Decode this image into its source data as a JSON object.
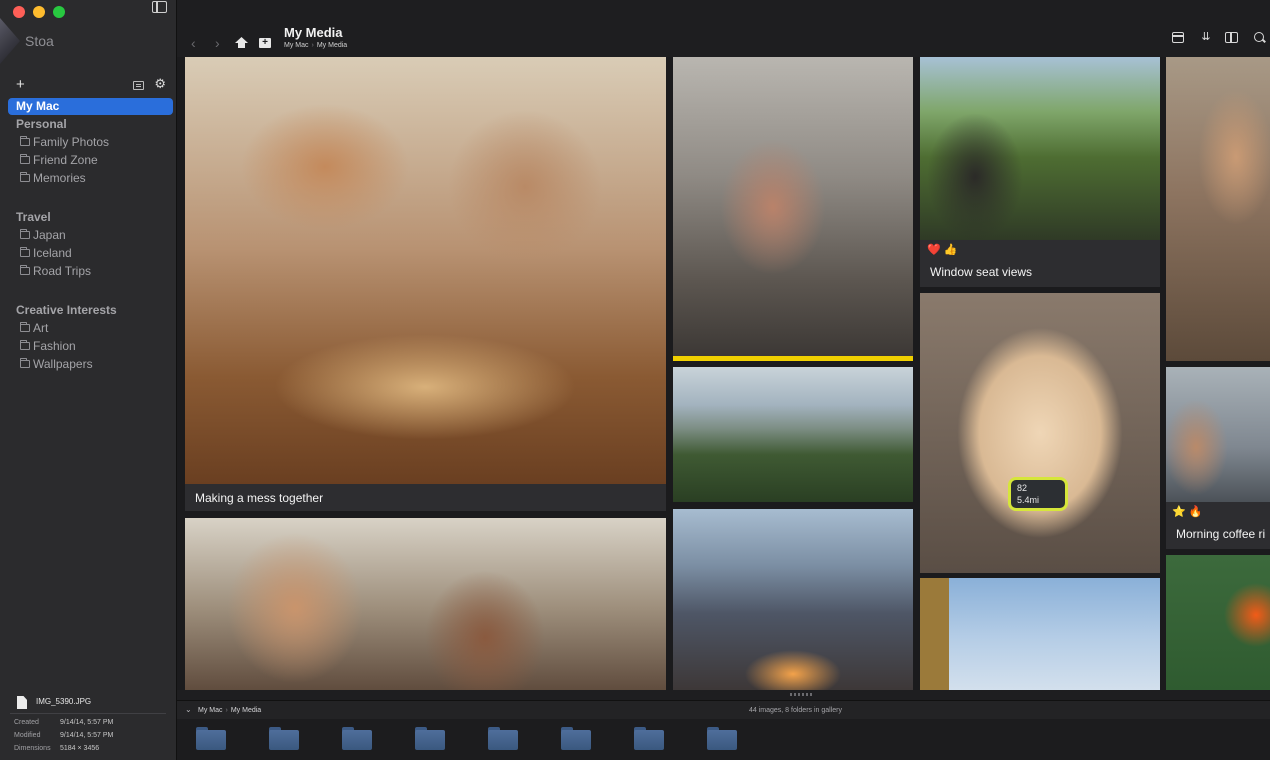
{
  "sidebar": {
    "brand": "Stoa",
    "add_label": "+",
    "active_item": "My Mac",
    "sections": [
      {
        "title": "Personal",
        "folders": [
          "Family Photos",
          "Friend Zone",
          "Memories"
        ]
      },
      {
        "title": "Travel",
        "folders": [
          "Japan",
          "Iceland",
          "Road Trips"
        ]
      },
      {
        "title": "Creative Interests",
        "folders": [
          "Art",
          "Fashion",
          "Wallpapers"
        ]
      }
    ]
  },
  "file_info": {
    "file_name": "IMG_5390.JPG",
    "rows": [
      {
        "label": "Created",
        "value": "9/14/14, 5:57 PM"
      },
      {
        "label": "Modified",
        "value": "9/14/14, 5:57 PM"
      },
      {
        "label": "Dimensions",
        "value": "5184 × 3456"
      }
    ]
  },
  "toolbar": {
    "title": "My Media",
    "breadcrumb": [
      "My Mac",
      "My Media"
    ],
    "icons": [
      "back-icon",
      "forward-icon",
      "home-icon",
      "new-folder-icon",
      "layout-icon",
      "sort-icon",
      "columns-icon",
      "zoom-icon"
    ]
  },
  "gallery": {
    "tiles": [
      {
        "name": "kids-baking",
        "caption": "Making a mess together",
        "reactions": ""
      },
      {
        "name": "woman-coffee",
        "caption": "",
        "reactions": "",
        "selected": true
      },
      {
        "name": "train-window",
        "caption": "Window seat views",
        "reactions": "❤️ 👍"
      },
      {
        "name": "cyclist",
        "caption": "",
        "reactions": ""
      },
      {
        "name": "mountains",
        "caption": "",
        "reactions": ""
      },
      {
        "name": "french-bulldog",
        "caption": "",
        "reactions": "",
        "watch_text": [
          "82",
          "5.4mi"
        ]
      },
      {
        "name": "coffee-friends",
        "caption": "Morning coffee ri",
        "reactions": "⭐ 🔥"
      },
      {
        "name": "market-friends",
        "caption": "",
        "reactions": ""
      },
      {
        "name": "beach-campfire",
        "caption": "",
        "reactions": ""
      },
      {
        "name": "skateboarder",
        "caption": "",
        "reactions": ""
      },
      {
        "name": "nasturtium-leaf",
        "caption": "",
        "reactions": ""
      }
    ],
    "selection_color": "#f0d000"
  },
  "pathbar": {
    "crumbs": [
      "My Mac",
      "My Media"
    ],
    "count_text": "44 images, 8 folders in gallery"
  },
  "folder_strip": {
    "folder_count": 8
  },
  "colors": {
    "accent": "#2a6edb",
    "background": "#1e1e20",
    "sidebar": "#2b2b2d"
  }
}
